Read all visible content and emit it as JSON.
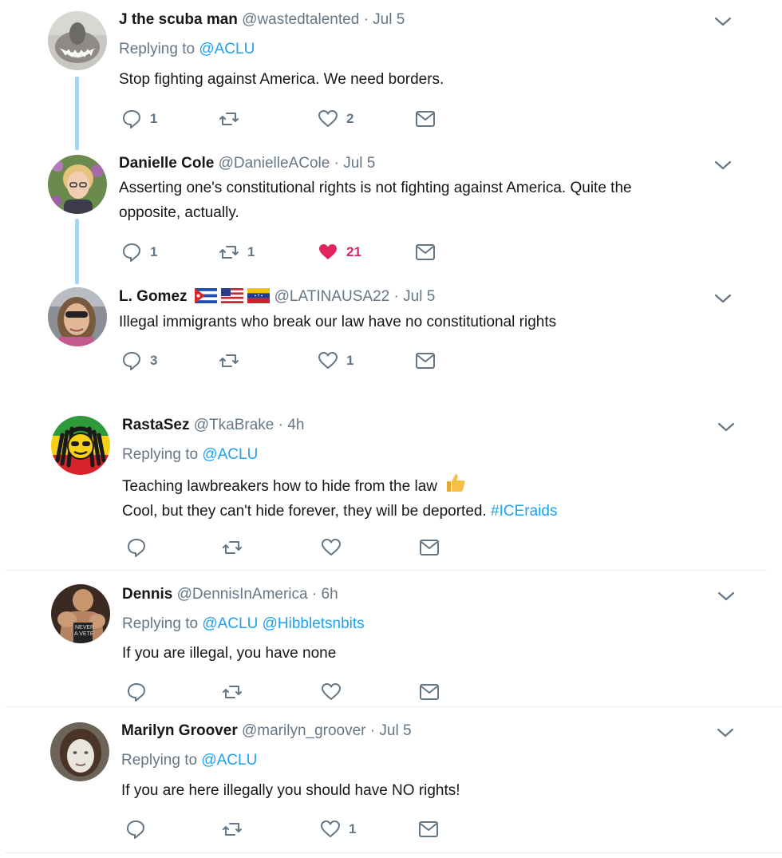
{
  "tweets": [
    {
      "name": "J the scuba man",
      "handle": "@wastedtalented",
      "dot": "·",
      "time": "Jul 5",
      "replying_prefix": "Replying to",
      "replying_to": "@ACLU",
      "text": "Stop fighting against America.  We need borders.",
      "replies": "1",
      "retweets": "",
      "likes": "2"
    },
    {
      "name": "Danielle Cole",
      "handle": "@DanielleACole",
      "dot": "·",
      "time": "Jul 5",
      "text_line1": "Asserting one's constitutional rights is not fighting against America. Quite the",
      "text_line2": "opposite, actually.",
      "replies": "1",
      "retweets": "1",
      "likes": "21",
      "liked": true
    },
    {
      "name": "L. Gomez",
      "handle": "@LATINAUSA22",
      "dot": "·",
      "time": "Jul 5",
      "flag_icons": [
        "cuba-flag-icon",
        "usa-flag-icon",
        "venezuela-flag-icon"
      ],
      "text": "Illegal immigrants who break our law have no constitutional rights",
      "replies": "3",
      "retweets": "",
      "likes": "1"
    },
    {
      "name": "RastaSez",
      "handle": "@TkaBrake",
      "dot": "·",
      "time": "4h",
      "replying_prefix": "Replying to",
      "replying_to": "@ACLU",
      "text_line1": "Teaching lawbreakers how to hide from the law",
      "emoji": "thumbs-up-icon",
      "text_line2": "Cool, but they can't hide forever, they will be deported.",
      "hashtag": "#ICEraids",
      "replies": "",
      "retweets": "",
      "likes": ""
    },
    {
      "name": "Dennis",
      "handle": "@DennisInAmerica",
      "dot": "·",
      "time": "6h",
      "replying_prefix": "Replying to",
      "replying_to": "@ACLU",
      "replying_to_2": "@Hibbletsnbits",
      "avatar_text_1": "NEVER",
      "avatar_text_2": "A VETE",
      "text": "If you are illegal, you have none",
      "replies": "",
      "retweets": "",
      "likes": ""
    },
    {
      "name": "Marilyn Groover",
      "handle": "@marilyn_groover",
      "dot": "·",
      "time": "Jul 5",
      "replying_prefix": "Replying to",
      "replying_to": "@ACLU",
      "text": "If you are here illegally you should have NO rights!",
      "replies": "",
      "retweets": "",
      "likes": "1"
    }
  ],
  "colors": {
    "link": "#1da1f2",
    "muted": "#657786",
    "like": "#e0245e",
    "thread": "#a6d4f2"
  }
}
